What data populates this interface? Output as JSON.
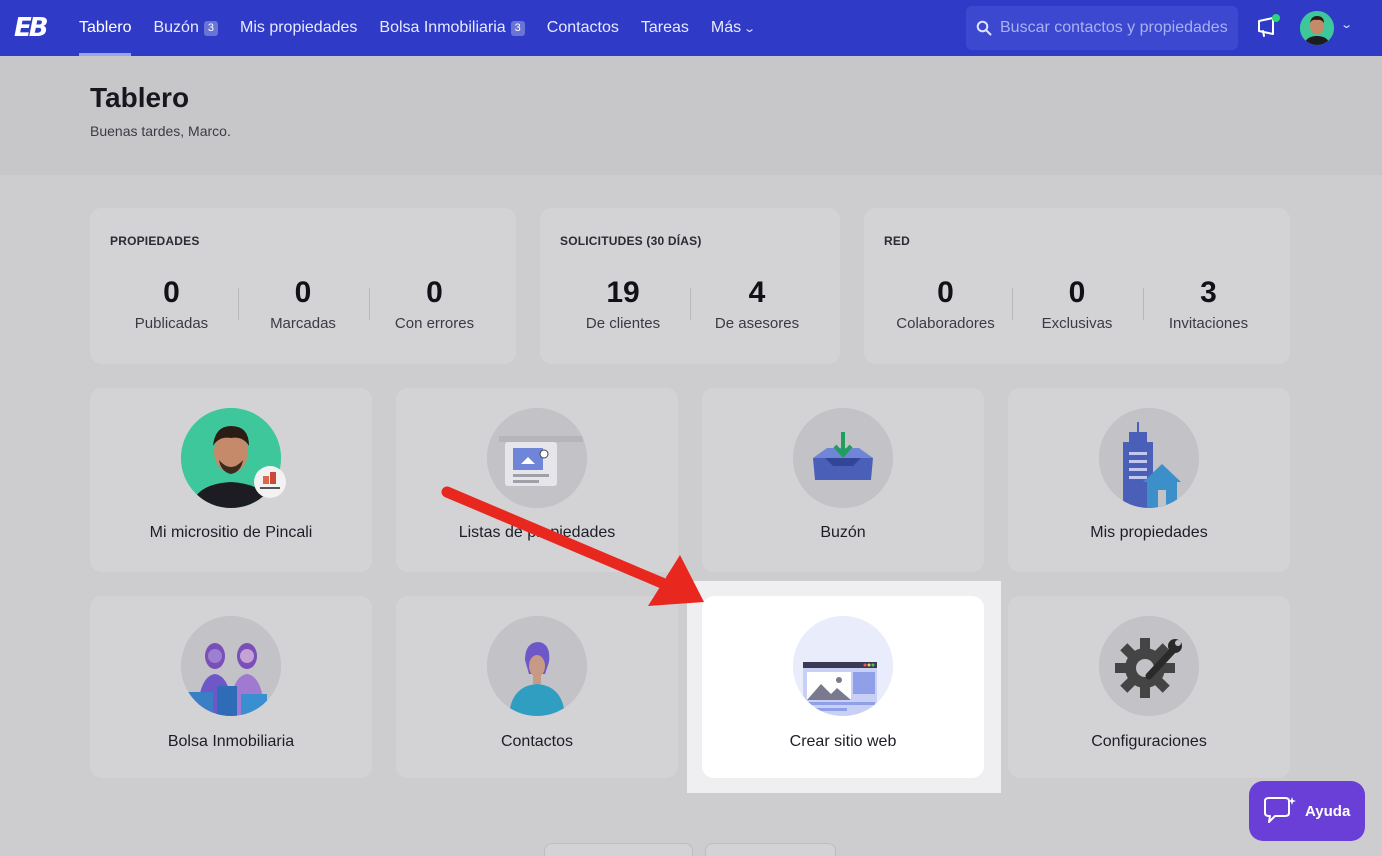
{
  "nav": {
    "logo": "EB",
    "items": [
      {
        "label": "Tablero"
      },
      {
        "label": "Buzón",
        "badge": "3"
      },
      {
        "label": "Mis propiedades"
      },
      {
        "label": "Bolsa Inmobiliaria",
        "badge": "3"
      },
      {
        "label": "Contactos"
      },
      {
        "label": "Tareas"
      },
      {
        "label": "Más"
      }
    ],
    "search_placeholder": "Buscar contactos y propiedades"
  },
  "header": {
    "title": "Tablero",
    "greeting": "Buenas tardes, Marco."
  },
  "stats": [
    {
      "title": "PROPIEDADES",
      "items": [
        {
          "value": "0",
          "label": "Publicadas"
        },
        {
          "value": "0",
          "label": "Marcadas"
        },
        {
          "value": "0",
          "label": "Con errores"
        }
      ]
    },
    {
      "title": "SOLICITUDES (30 DÍAS)",
      "items": [
        {
          "value": "19",
          "label": "De clientes"
        },
        {
          "value": "4",
          "label": "De asesores"
        }
      ]
    },
    {
      "title": "RED",
      "items": [
        {
          "value": "0",
          "label": "Colaboradores"
        },
        {
          "value": "0",
          "label": "Exclusivas"
        },
        {
          "value": "3",
          "label": "Invitaciones"
        }
      ]
    }
  ],
  "tiles": [
    {
      "label": "Mi micrositio de Pincali",
      "icon": "profile-photo-icon"
    },
    {
      "label": "Listas de propiedades",
      "icon": "property-list-icon"
    },
    {
      "label": "Buzón",
      "icon": "inbox-icon"
    },
    {
      "label": "Mis propiedades",
      "icon": "building-house-icon"
    },
    {
      "label": "Bolsa Inmobiliaria",
      "icon": "agents-market-icon"
    },
    {
      "label": "Contactos",
      "icon": "contact-person-icon"
    },
    {
      "label": "Crear sitio web",
      "icon": "website-builder-icon"
    },
    {
      "label": "Configuraciones",
      "icon": "settings-gear-icon"
    }
  ],
  "help": {
    "label": "Ayuda"
  },
  "colors": {
    "nav": "#2f3bc6",
    "accent_arrow": "#e8281f",
    "help": "#6a3fd8"
  }
}
